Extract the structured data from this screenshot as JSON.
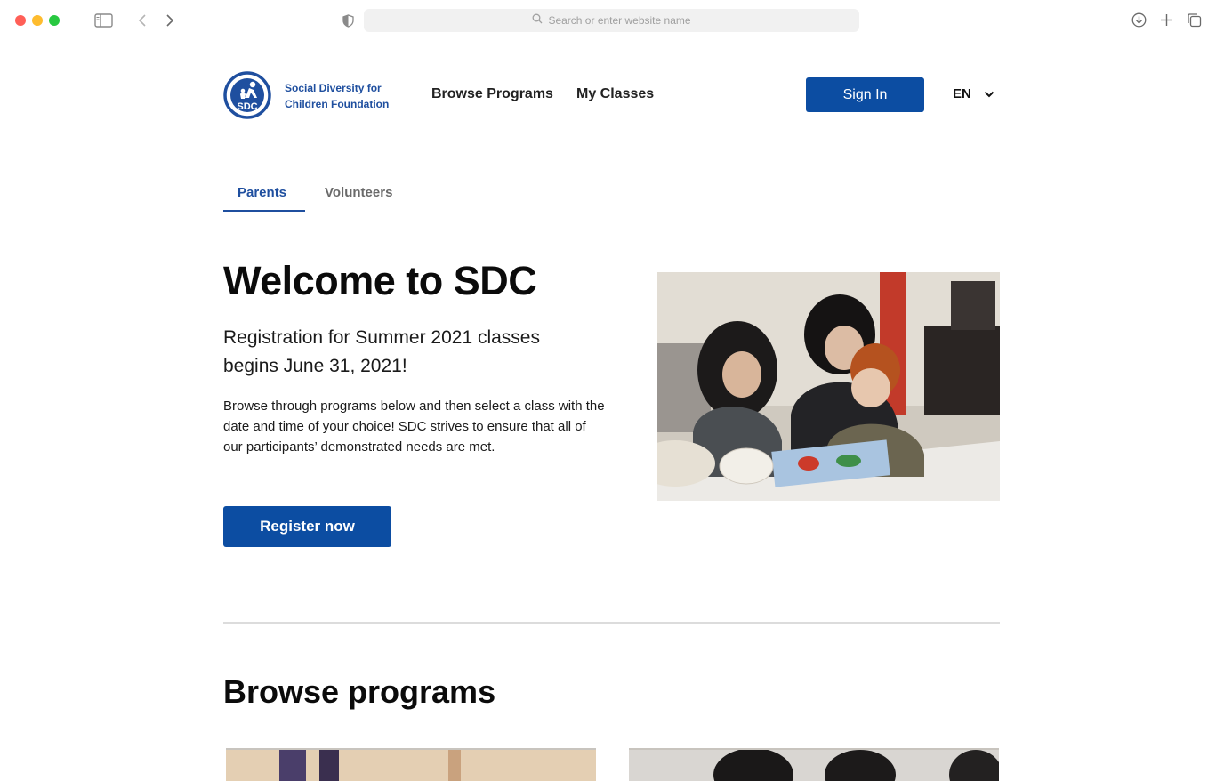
{
  "browser": {
    "url_placeholder": "Search or enter website name"
  },
  "header": {
    "logo_text": "SDC",
    "org_name": "Social Diversity for Children Foundation",
    "nav": [
      "Browse Programs",
      "My Classes"
    ],
    "signin_label": "Sign In",
    "language": "EN"
  },
  "tabs": [
    "Parents",
    "Volunteers"
  ],
  "hero": {
    "title": "Welcome to SDC",
    "subtitle": "Registration for Summer 2021 classes begins June 31, 2021!",
    "body": "Browse through programs below and then select a class with the date and time of your choice! SDC strives to ensure that all of our participants’ demonstrated needs are met.",
    "cta_label": "Register now"
  },
  "programs": {
    "title": "Browse programs"
  },
  "colors": {
    "brand_blue": "#0c4da2",
    "link_blue": "#1f4f9f"
  }
}
